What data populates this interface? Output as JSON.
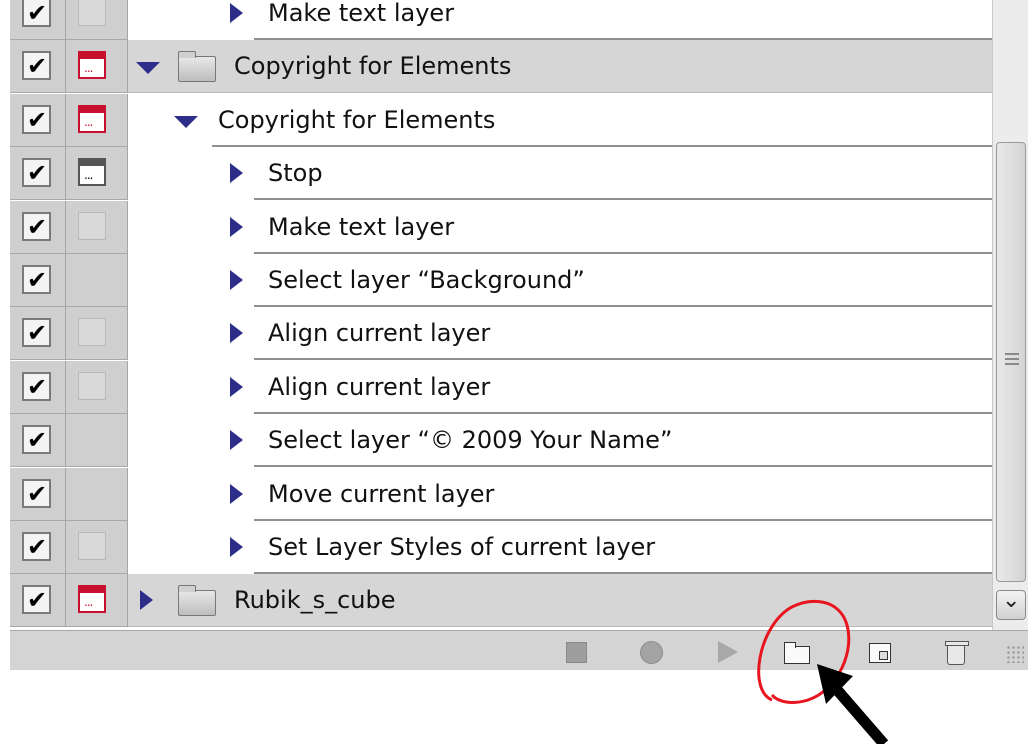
{
  "actions_panel": {
    "rows": [
      {
        "type": "step",
        "label": "Make text layer",
        "checked": true,
        "dialog": "empty",
        "expanded": false
      },
      {
        "type": "group",
        "label": "Copyright for Elements",
        "checked": true,
        "dialog": "red",
        "expanded": true
      },
      {
        "type": "set",
        "label": "Copyright for Elements",
        "checked": true,
        "dialog": "red",
        "expanded": true
      },
      {
        "type": "step",
        "label": "Stop",
        "checked": true,
        "dialog": "dark",
        "expanded": false
      },
      {
        "type": "step",
        "label": "Make text layer",
        "checked": true,
        "dialog": "empty",
        "expanded": false
      },
      {
        "type": "step",
        "label": "Select layer “Background”",
        "checked": true,
        "dialog": "none",
        "expanded": false
      },
      {
        "type": "step",
        "label": "Align current layer",
        "checked": true,
        "dialog": "empty",
        "expanded": false
      },
      {
        "type": "step",
        "label": "Align current layer",
        "checked": true,
        "dialog": "empty",
        "expanded": false
      },
      {
        "type": "step",
        "label": "Select layer “© 2009 Your Name”",
        "checked": true,
        "dialog": "none",
        "expanded": false
      },
      {
        "type": "step",
        "label": "Move current layer",
        "checked": true,
        "dialog": "none",
        "expanded": false
      },
      {
        "type": "step",
        "label": "Set Layer Styles of current layer",
        "checked": true,
        "dialog": "empty",
        "expanded": false
      },
      {
        "type": "group",
        "label": "Rubik_s_cube",
        "checked": true,
        "dialog": "red",
        "expanded": false
      }
    ]
  },
  "toolbar": {
    "buttons": [
      "stop-icon",
      "record-icon",
      "play-icon",
      "new-set-folder-icon",
      "new-action-icon",
      "trash-icon"
    ],
    "highlighted": "new-set-folder-icon"
  },
  "colors": {
    "annotation": "#e8141e",
    "dialog_red": "#c8102e",
    "triangle": "#2d2d8a",
    "group_row_bg": "#d6d6d6"
  }
}
